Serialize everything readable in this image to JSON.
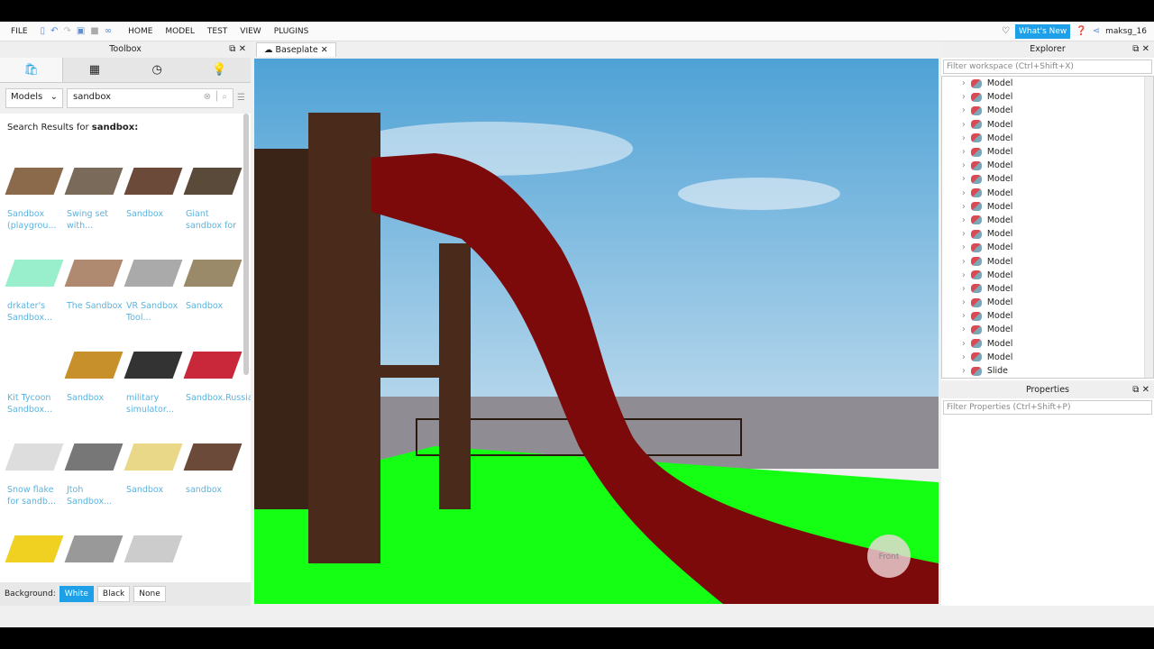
{
  "menubar": {
    "file": "FILE",
    "items": [
      "HOME",
      "MODEL",
      "TEST",
      "VIEW",
      "PLUGINS"
    ],
    "whats_new": "What's New",
    "user": "maksg_16"
  },
  "toolbox": {
    "title": "Toolbox",
    "category": "Models",
    "search_value": "sandbox",
    "results_prefix": "Search Results for",
    "results_query": "sandbox:",
    "items": [
      {
        "label": "Sandbox (playgrou...",
        "color": "#8a6a4a"
      },
      {
        "label": "Swing set with...",
        "color": "#7a6a5a"
      },
      {
        "label": "Sandbox",
        "color": "#6b4a3a"
      },
      {
        "label": "Giant sandbox for",
        "color": "#5a4a3a"
      },
      {
        "label": "drkater's Sandbox...",
        "color": "#9ec"
      },
      {
        "label": "The Sandbox",
        "color": "#b08a70"
      },
      {
        "label": "VR Sandbox Tool...",
        "color": "#aaa"
      },
      {
        "label": "Sandbox",
        "color": "#9a8a6a"
      },
      {
        "label": "Kit Tycoon Sandbox...",
        "color": "#fff"
      },
      {
        "label": "Sandbox",
        "color": "#c8902a"
      },
      {
        "label": "military simulator...",
        "color": "#333"
      },
      {
        "label": "Sandbox.Russia",
        "color": "#c8283a"
      },
      {
        "label": "Snow flake for sandb...",
        "color": "#ddd"
      },
      {
        "label": "Jtoh Sandbox...",
        "color": "#777"
      },
      {
        "label": "Sandbox",
        "color": "#e8d888"
      },
      {
        "label": "sandbox",
        "color": "#6b4a3a"
      },
      {
        "label": "",
        "color": "#f0d020"
      },
      {
        "label": "",
        "color": "#999"
      },
      {
        "label": "",
        "color": "#ccc"
      },
      {
        "label": "",
        "color": "#fff"
      }
    ],
    "background_label": "Background:",
    "bg_options": [
      "White",
      "Black",
      "None"
    ],
    "bg_selected": "White"
  },
  "viewport": {
    "tab": "Baseplate",
    "view_cube": "Front"
  },
  "explorer": {
    "title": "Explorer",
    "filter_placeholder": "Filter workspace (Ctrl+Shift+X)",
    "items": [
      "Model",
      "Model",
      "Model",
      "Model",
      "Model",
      "Model",
      "Model",
      "Model",
      "Model",
      "Model",
      "Model",
      "Model",
      "Model",
      "Model",
      "Model",
      "Model",
      "Model",
      "Model",
      "Model",
      "Model",
      "Model",
      "Slide"
    ]
  },
  "properties": {
    "title": "Properties",
    "filter_placeholder": "Filter Properties (Ctrl+Shift+P)"
  }
}
